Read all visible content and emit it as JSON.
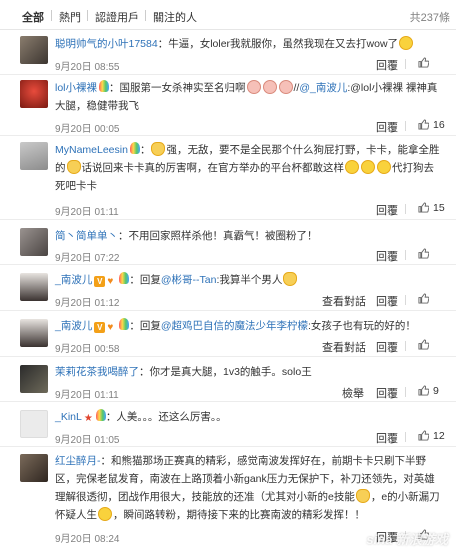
{
  "tabs": {
    "all": "全部",
    "hot": "熱門",
    "verified": "認證用戶",
    "following": "關注的人"
  },
  "total": "共237條",
  "colors": {
    "link": "#2e72b8",
    "meta": "#808080"
  },
  "comments": [
    {
      "user": "聪明帅气的小叶17584",
      "text": "：牛逼，女loler我就服你，虽然我现在又去打wow了",
      "date": "9月20日 08:55",
      "actions": [
        "回覆"
      ],
      "likes": ""
    },
    {
      "user": "lol小裸裸",
      "text": "：国服第一女杀神实至名归啊",
      "at": "@_南波儿",
      "text2": ":@lol小裸裸 裸神真大腿，稳健带我飞",
      "date": "9月20日 00:05",
      "actions": [
        "回覆"
      ],
      "likes": "16"
    },
    {
      "user": "MyNameLeesin",
      "text": "强，无敌，要不是全民那个什么狗屁打野，卡卡，能拿全胜的",
      "text2": "话说回来卡卡真的厉害啊，在官方举办的平台杯都敢这样",
      "text3": "代打狗去死吧卡卡",
      "date": "9月20日 01:11",
      "actions": [
        "回覆"
      ],
      "likes": "15"
    },
    {
      "user": "简丶简单单丶",
      "text": "：不用回家照样杀他！真霸气！被圈粉了！",
      "date": "9月20日 07:22",
      "actions": [
        "回覆"
      ],
      "likes": ""
    },
    {
      "user": "_南波儿",
      "text": "：回复",
      "at": "@彬哥--Tan",
      "text2": ":我算半个男人",
      "date": "9月20日 01:12",
      "actions": [
        "查看對話",
        "回覆"
      ],
      "likes": ""
    },
    {
      "user": "_南波儿",
      "text": "：回复",
      "at": "@超鸡巴自信的魔法少年李柠檬",
      "text2": ":女孩子也有玩的好的！",
      "date": "9月20日 00:58",
      "actions": [
        "查看對話",
        "回覆"
      ],
      "likes": ""
    },
    {
      "user": "茉莉花茶我喝醉了",
      "text": "：你才是真大腿，1v3的触手。solo王",
      "date": "9月20日 01:11",
      "actions": [
        "檢舉",
        "回覆"
      ],
      "likes": "9"
    },
    {
      "user": "_KinL",
      "text": "：人美。。。还这么厉害。。",
      "date": "9月20日 01:05",
      "actions": [
        "回覆"
      ],
      "likes": "12"
    },
    {
      "user": "红尘醉月-",
      "text": "：和熊猫那场正赛真的精彩，感觉南波发挥好在，前期卡卡只刷下半野区，完保老鼠发育，南波在上路顶着小新gank压力无保护下，补刀还领先，对英雄理解很透彻，团战作用很大，技能放的还准（尤其对小新的e技能",
      "text2": "，e的小新漏刀怀疑人生",
      "text3": "，瞬间路转粉，期待接下来的比赛南波的精彩发挥！！",
      "date": "9月20日 08:24",
      "actions": [
        "回覆"
      ],
      "likes": ""
    }
  ],
  "watermark": "sina 新浪游戏"
}
